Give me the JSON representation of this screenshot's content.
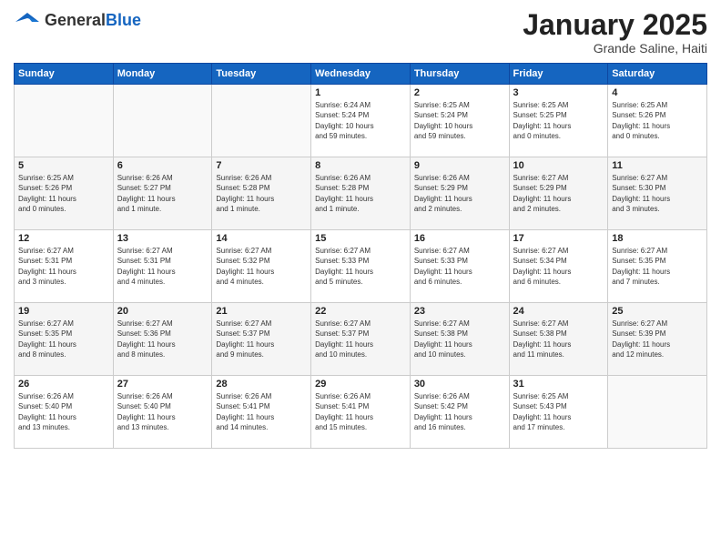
{
  "header": {
    "logo_general": "General",
    "logo_blue": "Blue",
    "month_title": "January 2025",
    "subtitle": "Grande Saline, Haiti"
  },
  "weekdays": [
    "Sunday",
    "Monday",
    "Tuesday",
    "Wednesday",
    "Thursday",
    "Friday",
    "Saturday"
  ],
  "weeks": [
    [
      {
        "day": "",
        "info": ""
      },
      {
        "day": "",
        "info": ""
      },
      {
        "day": "",
        "info": ""
      },
      {
        "day": "1",
        "info": "Sunrise: 6:24 AM\nSunset: 5:24 PM\nDaylight: 10 hours\nand 59 minutes."
      },
      {
        "day": "2",
        "info": "Sunrise: 6:25 AM\nSunset: 5:24 PM\nDaylight: 10 hours\nand 59 minutes."
      },
      {
        "day": "3",
        "info": "Sunrise: 6:25 AM\nSunset: 5:25 PM\nDaylight: 11 hours\nand 0 minutes."
      },
      {
        "day": "4",
        "info": "Sunrise: 6:25 AM\nSunset: 5:26 PM\nDaylight: 11 hours\nand 0 minutes."
      }
    ],
    [
      {
        "day": "5",
        "info": "Sunrise: 6:25 AM\nSunset: 5:26 PM\nDaylight: 11 hours\nand 0 minutes."
      },
      {
        "day": "6",
        "info": "Sunrise: 6:26 AM\nSunset: 5:27 PM\nDaylight: 11 hours\nand 1 minute."
      },
      {
        "day": "7",
        "info": "Sunrise: 6:26 AM\nSunset: 5:28 PM\nDaylight: 11 hours\nand 1 minute."
      },
      {
        "day": "8",
        "info": "Sunrise: 6:26 AM\nSunset: 5:28 PM\nDaylight: 11 hours\nand 1 minute."
      },
      {
        "day": "9",
        "info": "Sunrise: 6:26 AM\nSunset: 5:29 PM\nDaylight: 11 hours\nand 2 minutes."
      },
      {
        "day": "10",
        "info": "Sunrise: 6:27 AM\nSunset: 5:29 PM\nDaylight: 11 hours\nand 2 minutes."
      },
      {
        "day": "11",
        "info": "Sunrise: 6:27 AM\nSunset: 5:30 PM\nDaylight: 11 hours\nand 3 minutes."
      }
    ],
    [
      {
        "day": "12",
        "info": "Sunrise: 6:27 AM\nSunset: 5:31 PM\nDaylight: 11 hours\nand 3 minutes."
      },
      {
        "day": "13",
        "info": "Sunrise: 6:27 AM\nSunset: 5:31 PM\nDaylight: 11 hours\nand 4 minutes."
      },
      {
        "day": "14",
        "info": "Sunrise: 6:27 AM\nSunset: 5:32 PM\nDaylight: 11 hours\nand 4 minutes."
      },
      {
        "day": "15",
        "info": "Sunrise: 6:27 AM\nSunset: 5:33 PM\nDaylight: 11 hours\nand 5 minutes."
      },
      {
        "day": "16",
        "info": "Sunrise: 6:27 AM\nSunset: 5:33 PM\nDaylight: 11 hours\nand 6 minutes."
      },
      {
        "day": "17",
        "info": "Sunrise: 6:27 AM\nSunset: 5:34 PM\nDaylight: 11 hours\nand 6 minutes."
      },
      {
        "day": "18",
        "info": "Sunrise: 6:27 AM\nSunset: 5:35 PM\nDaylight: 11 hours\nand 7 minutes."
      }
    ],
    [
      {
        "day": "19",
        "info": "Sunrise: 6:27 AM\nSunset: 5:35 PM\nDaylight: 11 hours\nand 8 minutes."
      },
      {
        "day": "20",
        "info": "Sunrise: 6:27 AM\nSunset: 5:36 PM\nDaylight: 11 hours\nand 8 minutes."
      },
      {
        "day": "21",
        "info": "Sunrise: 6:27 AM\nSunset: 5:37 PM\nDaylight: 11 hours\nand 9 minutes."
      },
      {
        "day": "22",
        "info": "Sunrise: 6:27 AM\nSunset: 5:37 PM\nDaylight: 11 hours\nand 10 minutes."
      },
      {
        "day": "23",
        "info": "Sunrise: 6:27 AM\nSunset: 5:38 PM\nDaylight: 11 hours\nand 10 minutes."
      },
      {
        "day": "24",
        "info": "Sunrise: 6:27 AM\nSunset: 5:38 PM\nDaylight: 11 hours\nand 11 minutes."
      },
      {
        "day": "25",
        "info": "Sunrise: 6:27 AM\nSunset: 5:39 PM\nDaylight: 11 hours\nand 12 minutes."
      }
    ],
    [
      {
        "day": "26",
        "info": "Sunrise: 6:26 AM\nSunset: 5:40 PM\nDaylight: 11 hours\nand 13 minutes."
      },
      {
        "day": "27",
        "info": "Sunrise: 6:26 AM\nSunset: 5:40 PM\nDaylight: 11 hours\nand 13 minutes."
      },
      {
        "day": "28",
        "info": "Sunrise: 6:26 AM\nSunset: 5:41 PM\nDaylight: 11 hours\nand 14 minutes."
      },
      {
        "day": "29",
        "info": "Sunrise: 6:26 AM\nSunset: 5:41 PM\nDaylight: 11 hours\nand 15 minutes."
      },
      {
        "day": "30",
        "info": "Sunrise: 6:26 AM\nSunset: 5:42 PM\nDaylight: 11 hours\nand 16 minutes."
      },
      {
        "day": "31",
        "info": "Sunrise: 6:25 AM\nSunset: 5:43 PM\nDaylight: 11 hours\nand 17 minutes."
      },
      {
        "day": "",
        "info": ""
      }
    ]
  ]
}
